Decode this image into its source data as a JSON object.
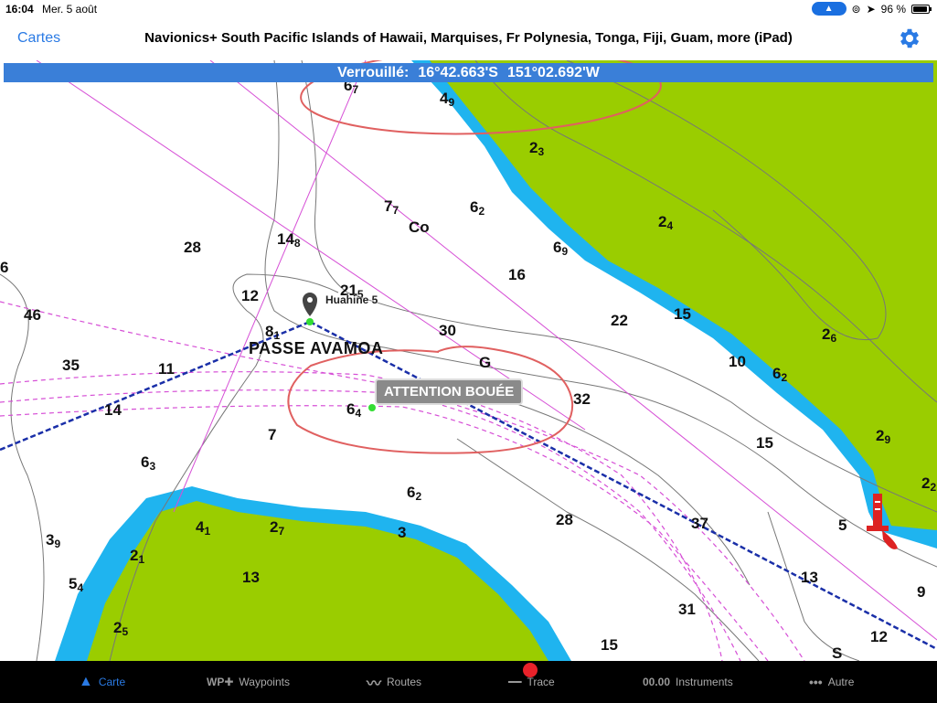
{
  "status_bar": {
    "time": "16:04",
    "date": "Mer. 5 août",
    "battery": "96 %",
    "battery_level": 0.96
  },
  "nav": {
    "back_label": "Cartes",
    "title": "Navionics+ South Pacific Islands of Hawaii, Marquises, Fr Polynesia, Tonga, Fiji, Guam, more (iPad)"
  },
  "lock_banner": {
    "label": "Verrouillé:",
    "latitude": "16°42.663'S",
    "longitude": "151°02.692'W"
  },
  "map": {
    "place_name": "PASSE AVAMOA",
    "waypoint_name": "Huahine 5",
    "buoy_warning": "ATTENTION BOUÉE",
    "seabed_labels": [
      "Co",
      "G",
      "S"
    ],
    "soundings": [
      {
        "v": "6",
        "s": "7"
      },
      {
        "v": "4",
        "s": "9"
      },
      {
        "v": "2",
        "s": "3"
      },
      {
        "v": "7",
        "s": "7"
      },
      {
        "v": "6",
        "s": "2"
      },
      {
        "v": "2",
        "s": "4"
      },
      {
        "v": "28",
        "s": ""
      },
      {
        "v": "14",
        "s": "8"
      },
      {
        "v": "6",
        "s": "9"
      },
      {
        "v": "16",
        "s": ""
      },
      {
        "v": "21",
        "s": "5"
      },
      {
        "v": "12",
        "s": ""
      },
      {
        "v": "46",
        "s": ""
      },
      {
        "v": "8",
        "s": "1"
      },
      {
        "v": "30",
        "s": ""
      },
      {
        "v": "22",
        "s": ""
      },
      {
        "v": "15",
        "s": ""
      },
      {
        "v": "2",
        "s": "6"
      },
      {
        "v": "35",
        "s": ""
      },
      {
        "v": "11",
        "s": ""
      },
      {
        "v": "10",
        "s": ""
      },
      {
        "v": "6",
        "s": "2"
      },
      {
        "v": "14",
        "s": ""
      },
      {
        "v": "6",
        "s": "4"
      },
      {
        "v": "32",
        "s": ""
      },
      {
        "v": "7",
        "s": ""
      },
      {
        "v": "15",
        "s": ""
      },
      {
        "v": "2",
        "s": "9"
      },
      {
        "v": "6",
        "s": "3"
      },
      {
        "v": "6",
        "s": "2"
      },
      {
        "v": "2",
        "s": "2"
      },
      {
        "v": "4",
        "s": "1"
      },
      {
        "v": "2",
        "s": "7"
      },
      {
        "v": "3",
        "s": ""
      },
      {
        "v": "28",
        "s": ""
      },
      {
        "v": "37",
        "s": ""
      },
      {
        "v": "5",
        "s": ""
      },
      {
        "v": "13",
        "s": ""
      },
      {
        "v": "3",
        "s": "9"
      },
      {
        "v": "2",
        "s": "1"
      },
      {
        "v": "13",
        "s": ""
      },
      {
        "v": "9",
        "s": ""
      },
      {
        "v": "5",
        "s": "4"
      },
      {
        "v": "31",
        "s": ""
      },
      {
        "v": "2",
        "s": "5"
      },
      {
        "v": "15",
        "s": ""
      },
      {
        "v": "12",
        "s": ""
      },
      {
        "v": "6",
        "s": ""
      }
    ],
    "colors": {
      "land": "#9acd00",
      "shallow_water": "#1fb4ef",
      "route": "#1a2fa8",
      "track": "#d64fd6",
      "annotation": "#e06060"
    }
  },
  "tabs": [
    {
      "icon": "▲",
      "label": "Carte"
    },
    {
      "icon": "WP✚",
      "label": "Waypoints"
    },
    {
      "icon": "〰",
      "label": "Routes"
    },
    {
      "icon": "━━",
      "label": "Trace"
    },
    {
      "icon": "00.00",
      "label": "Instruments"
    },
    {
      "icon": "•••",
      "label": "Autre"
    }
  ]
}
